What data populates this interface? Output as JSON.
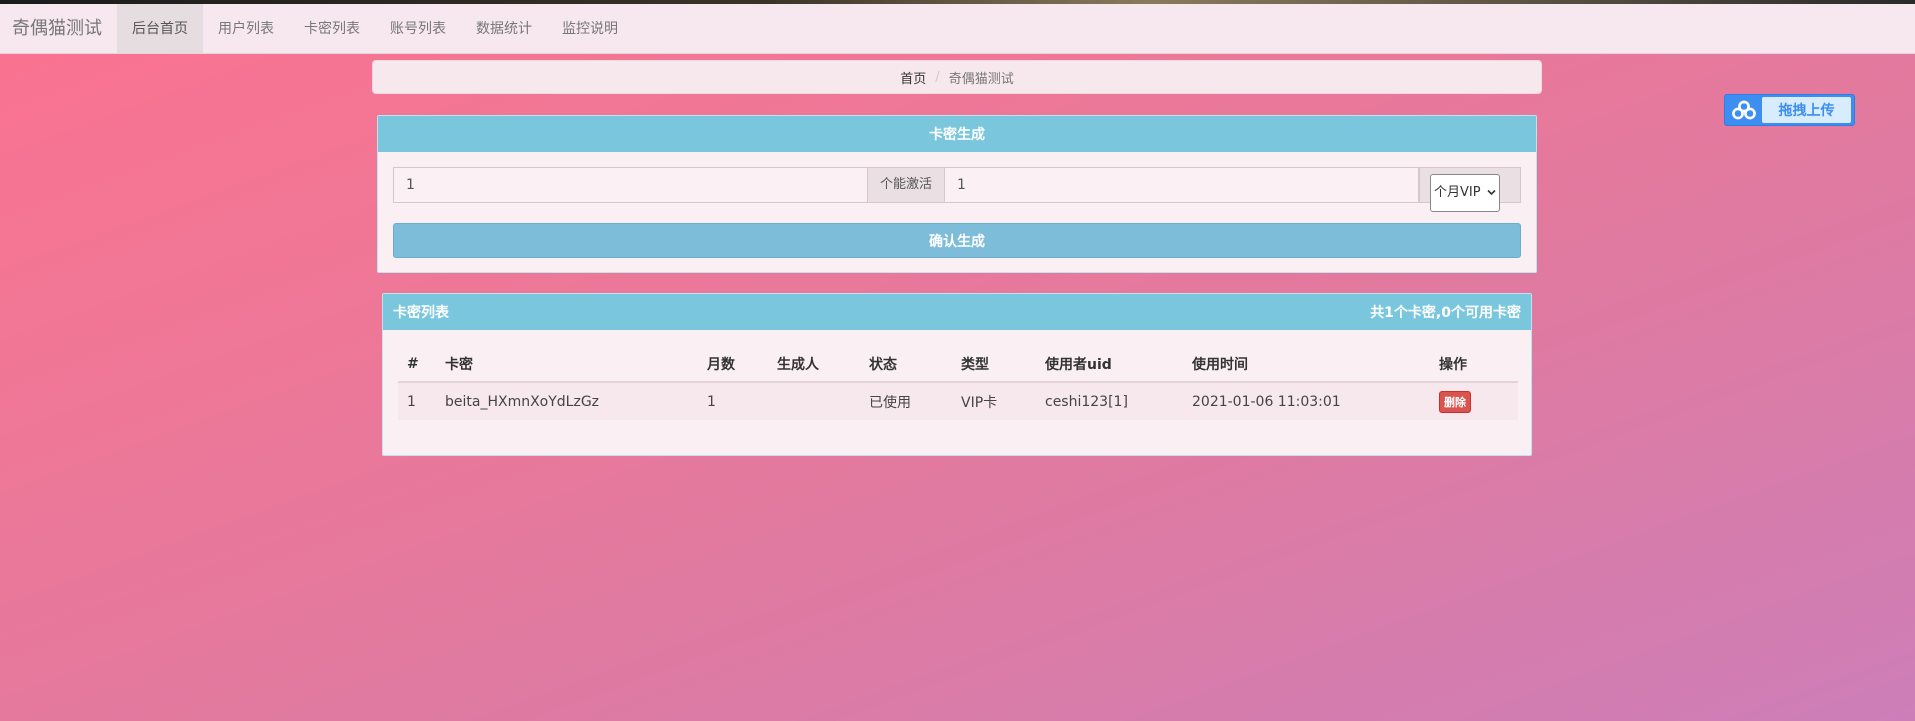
{
  "app": {
    "brand": "奇偶猫测试",
    "nav": [
      {
        "label": "后台首页",
        "active": true
      },
      {
        "label": "用户列表",
        "active": false
      },
      {
        "label": "卡密列表",
        "active": false
      },
      {
        "label": "账号列表",
        "active": false
      },
      {
        "label": "数据统计",
        "active": false
      },
      {
        "label": "监控说明",
        "active": false
      }
    ]
  },
  "breadcrumb": {
    "home": "首页",
    "separator": "/",
    "current": "奇偶猫测试"
  },
  "upload_widget": {
    "label": "拖拽上传",
    "icon": "cloud-icon",
    "color": "#3d8ef0"
  },
  "generate": {
    "title": "卡密生成",
    "count_value": "1",
    "addon_label": "个能激活",
    "months_value": "1",
    "type_selected": "个月VIP",
    "confirm_label": "确认生成"
  },
  "card_list": {
    "title": "卡密列表",
    "summary": "共1个卡密,0个可用卡密",
    "headers": [
      "#",
      "卡密",
      "月数",
      "生成人",
      "状态",
      "类型",
      "使用者uid",
      "使用时间",
      "操作"
    ],
    "rows": [
      {
        "index": "1",
        "card": "beita_HXmnXoYdLzGz",
        "months": "1",
        "creator": "",
        "status": "已使用",
        "type": "VIP卡",
        "uid": "ceshi123[1]",
        "time": "2021-01-06 11:03:01",
        "action": "删除"
      }
    ]
  },
  "colors": {
    "panel_heading": "#7ac7dd",
    "confirm_button": "#7dbdda",
    "delete_button": "#d9534f"
  }
}
